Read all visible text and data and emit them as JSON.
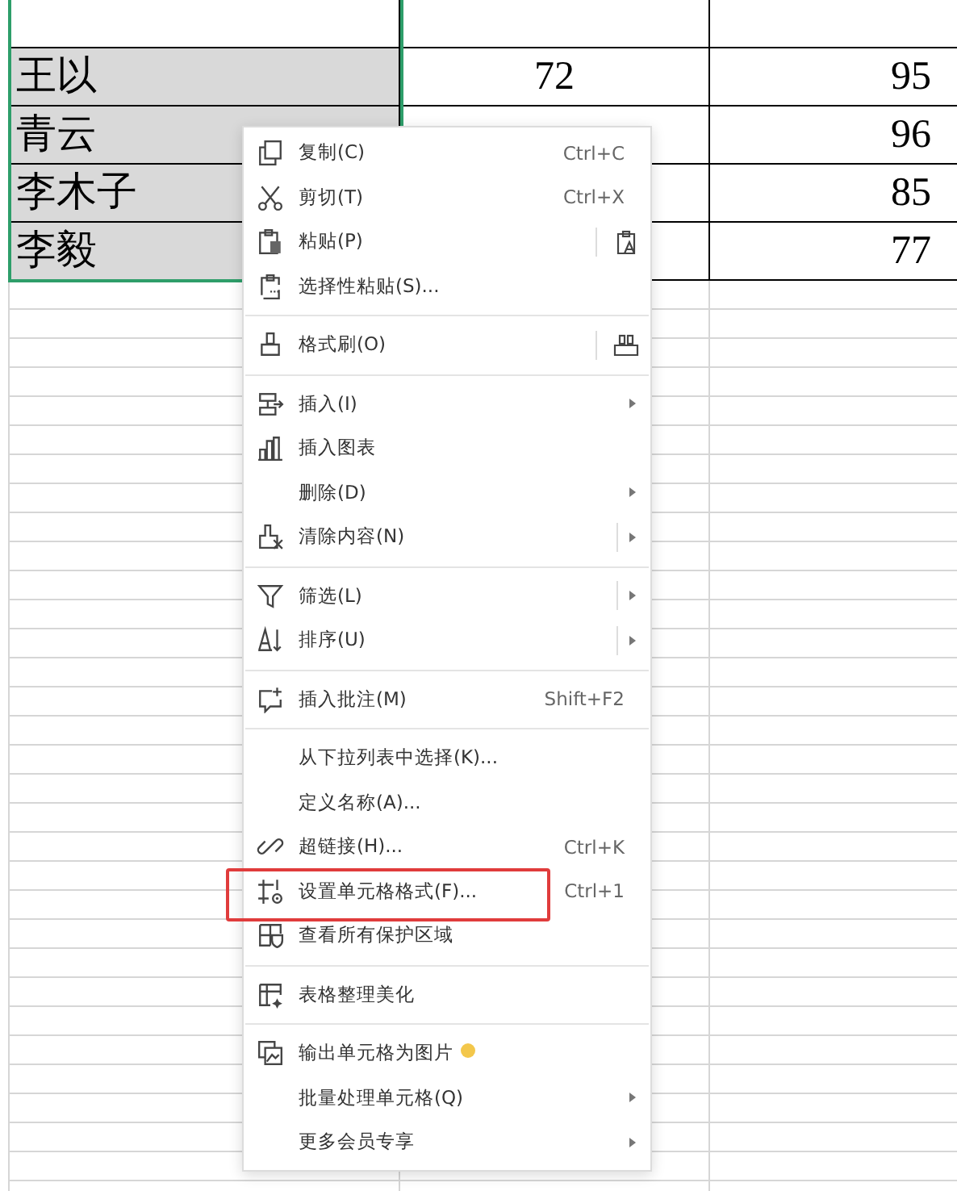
{
  "sheet": {
    "rows": [
      {
        "name": "王以",
        "col_b": "72",
        "col_c": "95",
        "selected": true
      },
      {
        "name": "青云",
        "col_c": "96",
        "selected": true
      },
      {
        "name": "李木子",
        "col_c": "85",
        "selected": true
      },
      {
        "name": "李毅",
        "col_c": "77",
        "selected": true
      }
    ]
  },
  "context_menu": {
    "sections": [
      [
        {
          "label": "复制(C)",
          "kind": "shortcut",
          "shortcut": "Ctrl+C",
          "highlighted": false
        },
        {
          "label": "剪切(T)",
          "kind": "shortcut",
          "shortcut": "Ctrl+X",
          "highlighted": false
        },
        {
          "label": "粘贴(P)",
          "kind": "side",
          "highlighted": false
        },
        {
          "label": "选择性粘贴(S)...",
          "kind": "plain",
          "highlighted": false
        }
      ],
      [
        {
          "label": "格式刷(O)",
          "kind": "side",
          "highlighted": false
        }
      ],
      [
        {
          "label": "插入(I)",
          "kind": "submenu",
          "highlighted": false
        },
        {
          "label": "插入图表",
          "kind": "plain",
          "highlighted": false
        },
        {
          "label": "删除(D)",
          "kind": "submenu",
          "highlighted": false
        },
        {
          "label": "清除内容(N)",
          "kind": "split",
          "highlighted": false
        }
      ],
      [
        {
          "label": "筛选(L)",
          "kind": "split",
          "highlighted": false
        },
        {
          "label": "排序(U)",
          "kind": "split",
          "highlighted": false
        }
      ],
      [
        {
          "label": "插入批注(M)",
          "kind": "shortcut",
          "shortcut": "Shift+F2",
          "highlighted": false
        }
      ],
      [
        {
          "label": "从下拉列表中选择(K)...",
          "kind": "plain",
          "highlighted": false
        },
        {
          "label": "定义名称(A)...",
          "kind": "plain",
          "highlighted": false
        },
        {
          "label": "超链接(H)...",
          "kind": "shortcut",
          "shortcut": "Ctrl+K",
          "highlighted": false
        },
        {
          "label": "设置单元格格式(F)...",
          "kind": "shortcut",
          "shortcut": "Ctrl+1",
          "highlighted": true
        },
        {
          "label": "查看所有保护区域",
          "kind": "plain",
          "highlighted": false
        }
      ],
      [
        {
          "label": "表格整理美化",
          "kind": "plain",
          "highlighted": false
        }
      ],
      [
        {
          "label": "输出单元格为图片",
          "kind": "badge",
          "highlighted": false
        },
        {
          "label": "批量处理单元格(Q)",
          "kind": "submenu",
          "highlighted": false
        },
        {
          "label": "更多会员专享",
          "kind": "submenu",
          "highlighted": false
        }
      ]
    ]
  }
}
